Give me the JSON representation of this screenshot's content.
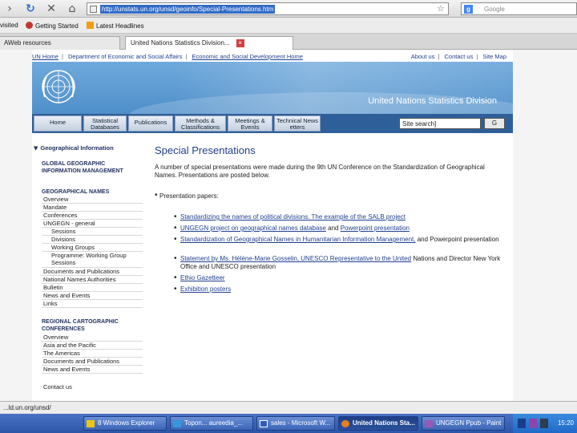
{
  "browser": {
    "url": "http://unstats.un.org/unsd/geoinfo/Special-Presentations.htm",
    "search_engine": "Google",
    "bookmarks": [
      "visited",
      "Getting Started",
      "Latest Headlines"
    ],
    "tabs": [
      {
        "title": "AWeb resources"
      },
      {
        "title": "United Nations Statistics Division..."
      }
    ]
  },
  "topnav": {
    "left": [
      "UN Home",
      "Department of Economic and Social Affairs",
      "Economic and Social Development Home"
    ],
    "right": [
      "About us",
      "Contact us",
      "Site Map"
    ]
  },
  "banner": {
    "division": "United Nations Statistics Division"
  },
  "menu": {
    "items": [
      "Home",
      "Statistical Databases",
      "Publications",
      "Methods & Classifications",
      "Meetings & Events",
      "Technical News etters"
    ],
    "search_value": "Site search]",
    "go_label": "G"
  },
  "sidebar": {
    "heading": "Geographical Information",
    "section1": "GLOBAL GEOGRAPHIC INFORMATION MANAGEMENT",
    "section2": "GEOGRAPHICAL NAMES",
    "items": [
      "Overview",
      "Mandate",
      "Conferences",
      "UNGEGN - general",
      "Sessions",
      "Divisions",
      "Working Groups",
      "Programme: Working Group Sessions",
      "Documents and Publications",
      "National Names Authorities",
      "Bulletin",
      "News and Events",
      "Links"
    ],
    "section3": "REGIONAL CARTOGRAPHIC CONFERENCES",
    "items2": [
      "Overview",
      "Asia and the Pacific",
      "The Americas",
      "Documents and Publications",
      "News and Events"
    ],
    "contact": "Contact us"
  },
  "content": {
    "title": "Special Presentations",
    "intro": "A number of special presentations were made during the 9th UN Conference on the Standardization of Geographical Names. Presentations are posted below.",
    "papers_label": "Presentation papers:",
    "links": [
      {
        "text": "Standardizing the names of political divisions. The example of the SALB project",
        "suffix": ""
      },
      {
        "text": "UNGEGN project on geographical names database",
        "suffix": " and ",
        "text2": "Powerpoint presentation"
      },
      {
        "text": "Standardization of Geographical Names in Humanitarian Information Management,",
        "suffix": " and Powerpoint presentation"
      },
      {
        "text": "Statement by Ms. Hélène-Marie Gosselin, UNESCO Representative to the United",
        "suffix": " Nations and Director New York Office and UNESCO presentation"
      },
      {
        "text": "Ethio Gazetteer",
        "suffix": ""
      },
      {
        "text": "Exhibition posters",
        "suffix": ""
      }
    ]
  },
  "status": {
    "text": "...ld.un.org/unsd/"
  },
  "taskbar": {
    "tasks": [
      "8 Windows Explorer",
      "Topon... aureedia_...",
      "sales - Microsoft W...",
      "United Nations Sta...",
      "UNGEGN Ppub - Paint"
    ],
    "clock": "15:20"
  }
}
